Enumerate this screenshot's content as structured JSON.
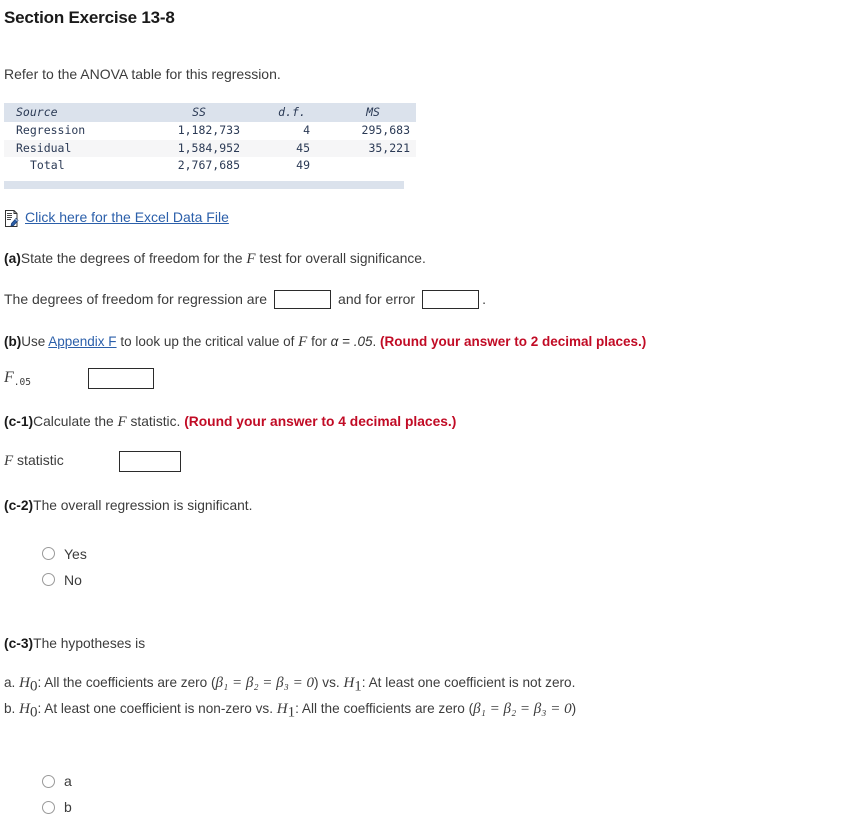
{
  "page": {
    "title": "Section Exercise 13-8",
    "intro": "Refer to the ANOVA table for this regression."
  },
  "anova_table": {
    "headers": [
      "Source",
      "SS",
      "d.f.",
      "MS"
    ],
    "rows": [
      {
        "source": "Regression",
        "ss": "1,182,733",
        "df": "4",
        "ms": "295,683"
      },
      {
        "source": "Residual",
        "ss": "1,584,952",
        "df": "45",
        "ms": "35,221"
      },
      {
        "source": "Total",
        "ss": "2,767,685",
        "df": "49",
        "ms": ""
      }
    ]
  },
  "excel": {
    "icon": "document-file-icon",
    "link_label": "Click here for the Excel Data File"
  },
  "part_a": {
    "label": "(a)",
    "text": "State the degrees of freedom for the F test for overall significance.",
    "text_before_f": "State the degrees of freedom for the ",
    "f_var": "F",
    "text_after_f": " test for overall significance.",
    "answer_prefix": "The degrees of freedom for regression are",
    "answer_middle": "and for error",
    "answer_suffix": ".",
    "regression_df_value": "",
    "error_df_value": ""
  },
  "part_b": {
    "label": "(b)",
    "text_1": "Use ",
    "link_label": "Appendix F",
    "text_2": " to look up the critical value of ",
    "f_var": "F",
    "text_3": " for ",
    "alpha": "α = .05",
    "text_4": ". ",
    "rounding_note": "(Round your answer to 2 decimal places.)",
    "field_label": "F",
    "field_subscript": ".05",
    "field_value": ""
  },
  "part_c1": {
    "label": "(c-1)",
    "text_1": "Calculate the ",
    "f_var": "F",
    "text_2": " statistic. ",
    "rounding_note": "(Round your answer to 4 decimal places.)",
    "field_label_var": "F",
    "field_label_rest": " statistic",
    "field_value": ""
  },
  "part_c2": {
    "label": "(c-2)",
    "text": "The overall regression is significant.",
    "options": [
      {
        "id": "yes",
        "label": "Yes",
        "selected": false
      },
      {
        "id": "no",
        "label": "No",
        "selected": false
      }
    ]
  },
  "part_c3": {
    "label": "(c-3)",
    "text": "The hypotheses is",
    "hypotheses": [
      {
        "key": "a.",
        "h0_var": "H",
        "h0_sub": "0",
        "h0_text": ": All the coefficients are zero (",
        "betas": "β₁ = β₂ = β₃ = 0",
        "mid_text": ") vs. ",
        "h1_var": "H",
        "h1_sub": "1",
        "h1_text": ": At least one coefficient is not zero."
      },
      {
        "key": "b.",
        "h0_var": "H",
        "h0_sub": "0",
        "h0_text": ": At least one coefficient is non-zero vs. ",
        "h1_var": "H",
        "h1_sub": "1",
        "h1_text": ": All the coefficients are zero (",
        "betas": "β₁ = β₂ = β₃ = 0",
        "end_text": ")"
      }
    ],
    "options": [
      {
        "id": "a",
        "label": "a",
        "selected": false
      },
      {
        "id": "b",
        "label": "b",
        "selected": false
      }
    ]
  },
  "colors": {
    "link": "#2b5faa",
    "rounding_note": "#c10b25",
    "table_header_bg": "#dbe2ec",
    "table_text": "#2b3a55",
    "body_text": "#3c3c3c"
  }
}
